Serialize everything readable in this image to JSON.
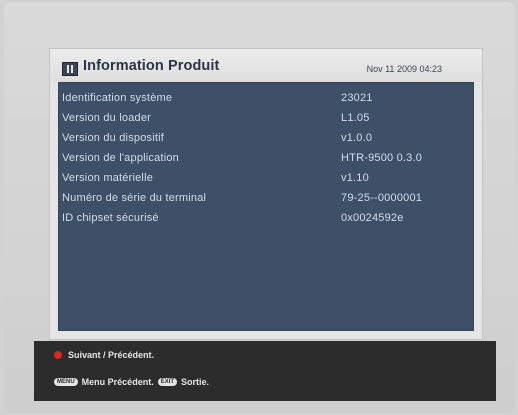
{
  "header": {
    "title": "Information Produit",
    "datetime": "Nov 11 2009 04:23",
    "icon": "info-box-icon"
  },
  "info_rows": [
    {
      "label": "Identification système",
      "value": "23021"
    },
    {
      "label": "Version du loader",
      "value": "L1.05"
    },
    {
      "label": "Version du dispositif",
      "value": "v1.0.0"
    },
    {
      "label": "Version de l'application",
      "value": "HTR-9500 0.3.0"
    },
    {
      "label": "Version matérielle",
      "value": "v1.10"
    },
    {
      "label": "Numéro de série du terminal",
      "value": "79-25--0000001"
    },
    {
      "label": "ID chipset sécurisé",
      "value": "0x0024592e"
    }
  ],
  "footer": {
    "hint1": "Suivant / Précédent.",
    "menu_key": "MENU",
    "menu_text": "Menu Précédent.",
    "exit_key": "EXIT",
    "exit_text": "Sortie."
  },
  "colors": {
    "panel_body": "#3d5068",
    "header_bg": "#e5e5e5",
    "footer_bg": "#2c2c2c",
    "red_button": "#e0251d"
  }
}
